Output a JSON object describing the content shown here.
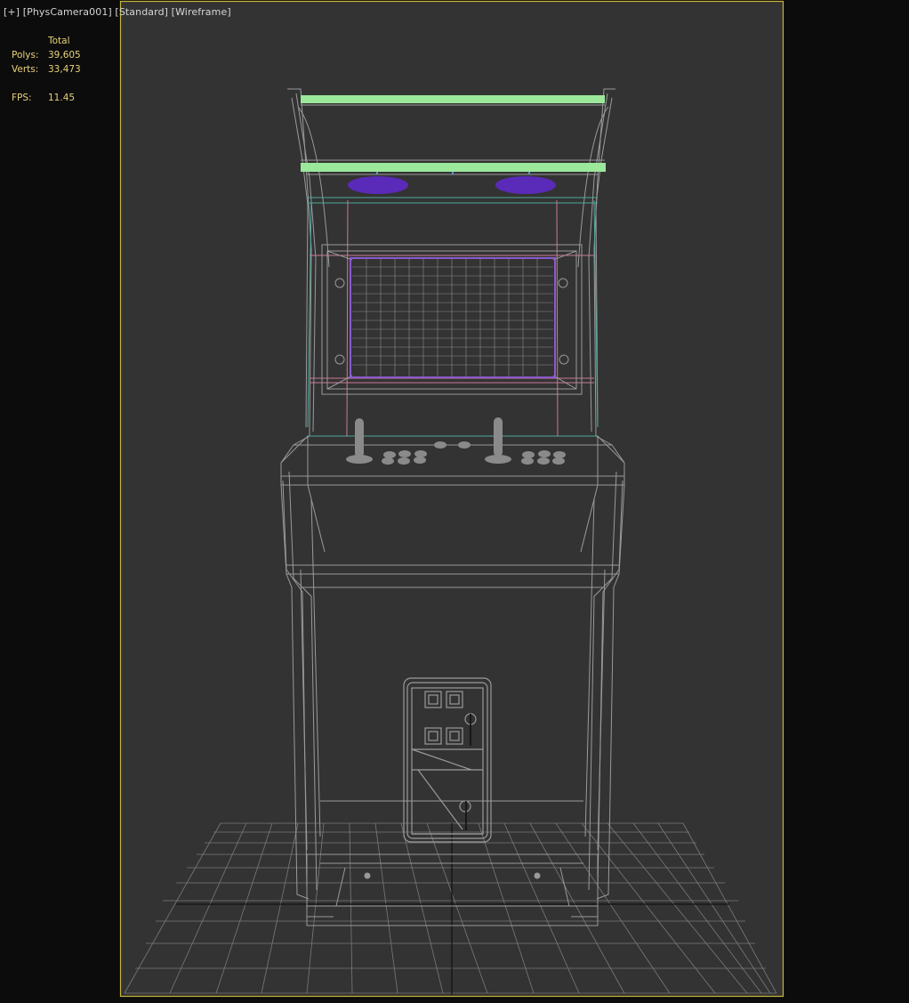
{
  "viewport": {
    "menu_plus": "[+]",
    "camera": "[PhysCamera001]",
    "shading": "[Standard]",
    "display_mode": "[Wireframe]"
  },
  "statistics": {
    "header": "Total",
    "polys_label": "Polys:",
    "polys_value": "39,605",
    "verts_label": "Verts:",
    "verts_value": "33,473",
    "fps_label": "FPS:",
    "fps_value": "11.45"
  },
  "colors": {
    "background": "#0c0c0c",
    "viewport_bg": "#333333",
    "safe_frame": "#c8b439",
    "wire": "#9a9a9a",
    "grid": "#787878",
    "marquee_light": "#9be89b",
    "speaker": "#5a2ab8",
    "screen_border": "#8a5ad0",
    "guide_pink": "#c87a9a",
    "guide_teal": "#4fa89c",
    "stats_text": "#e8d27a"
  }
}
